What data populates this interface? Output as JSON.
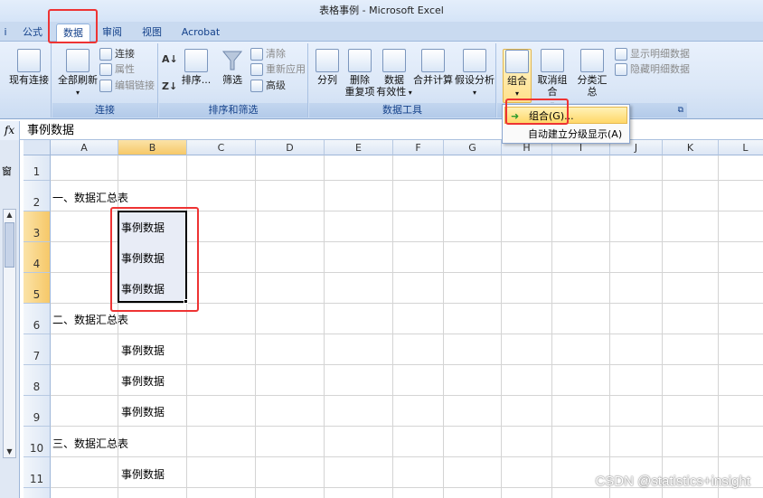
{
  "window": {
    "title": "表格事例 - Microsoft Excel"
  },
  "tabs": [
    {
      "label": "公式"
    },
    {
      "label": "数据"
    },
    {
      "label": "审阅"
    },
    {
      "label": "视图"
    },
    {
      "label": "Acrobat"
    }
  ],
  "ribbon": {
    "existing_conn": "现有连接",
    "refresh_all": "全部刷新",
    "connections": "连接",
    "properties": "属性",
    "edit_links": "编辑链接",
    "group_conn": "连接",
    "sort": "排序...",
    "filter": "筛选",
    "clear": "清除",
    "reapply": "重新应用",
    "advanced": "高级",
    "group_sort": "排序和筛选",
    "text_to_cols": "分列",
    "remove_dup_1": "删除",
    "remove_dup_2": "重复项",
    "validation_1": "数据",
    "validation_2": "有效性",
    "consolidate": "合并计算",
    "whatif": "假设分析",
    "group_tools": "数据工具",
    "group_btn": "组合",
    "ungroup_btn": "取消组合",
    "subtotal_btn": "分类汇总",
    "show_detail": "显示明细数据",
    "hide_detail": "隐藏明细数据"
  },
  "menu": {
    "item1": "组合(G)...",
    "item2": "自动建立分级显示(A)"
  },
  "formula_bar": {
    "fx": "fx",
    "content": "事例数据"
  },
  "left_pane": {
    "text": "窗"
  },
  "columns": [
    "A",
    "B",
    "C",
    "D",
    "E",
    "F",
    "G",
    "H",
    "I",
    "J",
    "K",
    "L"
  ],
  "rows": [
    "1",
    "2",
    "3",
    "4",
    "5",
    "6",
    "7",
    "8",
    "9",
    "10",
    "11"
  ],
  "cells": {
    "a2": "一、数据汇总表",
    "b3": "事例数据",
    "b4": "事例数据",
    "b5": "事例数据",
    "a6": "二、数据汇总表",
    "b7": "事例数据",
    "b8": "事例数据",
    "b9": "事例数据",
    "a10": "三、数据汇总表",
    "b11": "事例数据"
  },
  "watermark": "CSDN @statistics+insight"
}
